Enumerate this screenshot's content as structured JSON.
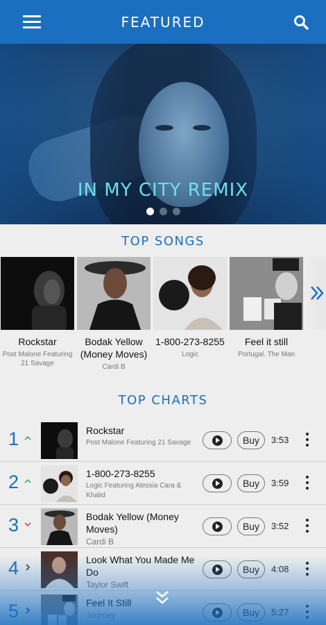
{
  "header": {
    "title": "FEATURED"
  },
  "hero": {
    "title": "IN MY CITY REMIX",
    "slide_count": 3,
    "active_slide": 0
  },
  "top_songs": {
    "title": "TOP SONGS",
    "items": [
      {
        "title": "Rockstar",
        "artist": "Post Malone Featuring 21 Savage"
      },
      {
        "title": "Bodak Yellow (Money Moves)",
        "artist": "Cardi B"
      },
      {
        "title": "1-800-273-8255",
        "artist": "Logic"
      },
      {
        "title": "Feel it still",
        "artist": "Portugal. The Man"
      }
    ]
  },
  "top_charts": {
    "title": "TOP CHARTS",
    "buy_label": "Buy",
    "rows": [
      {
        "rank": "1",
        "trend": "up",
        "title": "Rockstar",
        "artist": "Post Malone Featuring 21 Savage",
        "duration": "3:53"
      },
      {
        "rank": "2",
        "trend": "up",
        "title": "1-800-273-8255",
        "artist": "Logic Featuring Alessia Cara & Khalid",
        "duration": "3:59"
      },
      {
        "rank": "3",
        "trend": "down",
        "title": "Bodak Yellow (Money Moves)",
        "artist": "Cardi B",
        "duration": "3:52"
      },
      {
        "rank": "4",
        "trend": "same",
        "title": "Look What You Made Me Do",
        "artist": "Taylor Swift",
        "duration": "4:08"
      },
      {
        "rank": "5",
        "trend": "same",
        "title": "Feel It Still",
        "artist": "Journey",
        "duration": "5:27"
      }
    ]
  },
  "colors": {
    "brand": "#1a6fc0",
    "hero_text": "#6fe0ea",
    "trend_up": "#2aa84a",
    "trend_down": "#d0303a"
  },
  "icons": [
    "menu-icon",
    "search-icon",
    "chevron-double-right-icon",
    "play-icon",
    "more-vertical-icon",
    "chevron-double-down-icon"
  ]
}
